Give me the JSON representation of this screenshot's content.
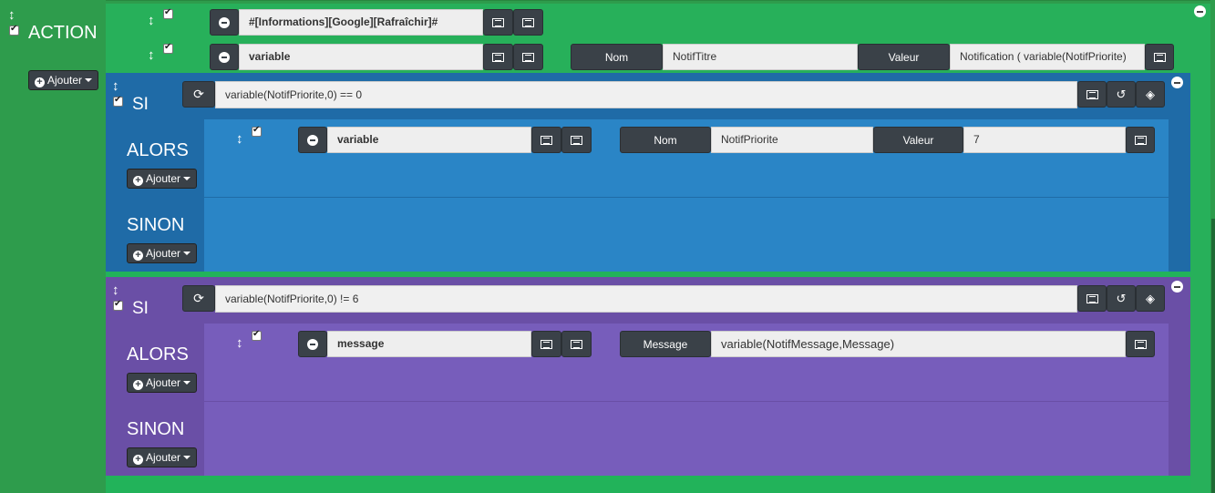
{
  "action": {
    "title": "ACTION",
    "ajouter_label": "Ajouter",
    "rows": [
      {
        "value": "#[Informations][Google][Rafraîchir]#"
      },
      {
        "value": "variable",
        "name_label": "Nom",
        "name_value": "NotifTitre",
        "val_label": "Valeur",
        "val_value": "Notification ( variable(NotifPriorite)"
      }
    ]
  },
  "si_blocks": [
    {
      "si_label": "SI",
      "condition": "variable(NotifPriorite,0) == 0",
      "alors_label": "ALORS",
      "sinon_label": "SINON",
      "ajouter_label": "Ajouter",
      "action": {
        "value": "variable",
        "name_label": "Nom",
        "name_value": "NotifPriorite",
        "val_label": "Valeur",
        "val_value": "7"
      }
    },
    {
      "si_label": "SI",
      "condition": "variable(NotifPriorite,0) != 6",
      "alors_label": "ALORS",
      "sinon_label": "SINON",
      "ajouter_label": "Ajouter",
      "action": {
        "value": "message",
        "msg_label": "Message",
        "msg_value": "variable(NotifMessage,Message)"
      }
    }
  ],
  "colors": {
    "green_outer": "#2e9c4c",
    "green_inner": "#27b05a",
    "blue": "#2a85c6",
    "purple": "#775dbb",
    "dark_button": "#3a4148"
  }
}
